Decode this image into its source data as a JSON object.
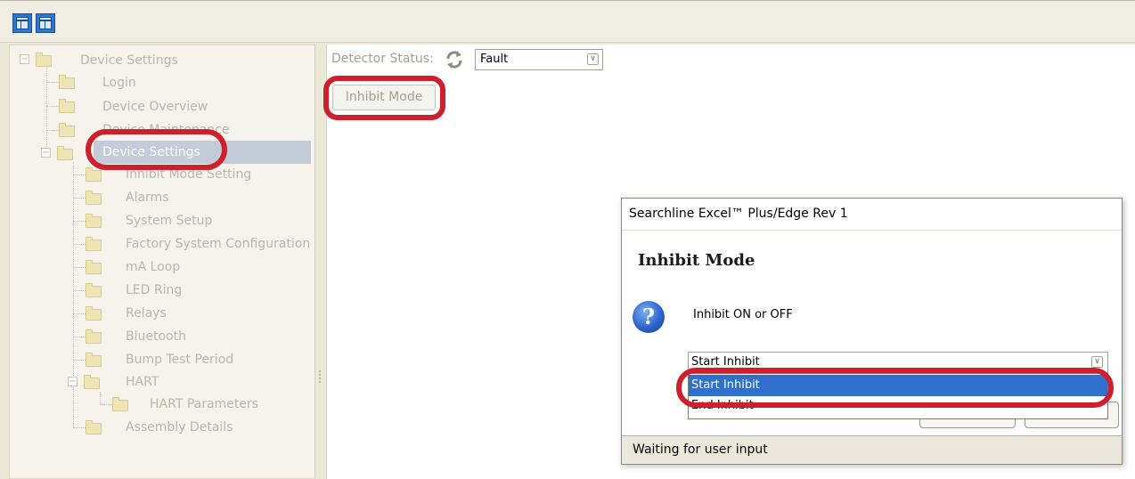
{
  "toolbar": {
    "buttons": [
      {
        "icon": "layout-icon"
      },
      {
        "icon": "layout-split-icon"
      }
    ]
  },
  "tree": {
    "root": "Device Settings",
    "items": [
      {
        "label": "Login"
      },
      {
        "label": "Device Overview"
      },
      {
        "label": "Device Maintenance"
      },
      {
        "label": "Device Settings",
        "selected": true
      },
      {
        "label": "Inhibit Mode Setting"
      },
      {
        "label": "Alarms"
      },
      {
        "label": "System Setup"
      },
      {
        "label": "Factory System Configuration"
      },
      {
        "label": "mA Loop"
      },
      {
        "label": "LED Ring"
      },
      {
        "label": "Relays"
      },
      {
        "label": "Bluetooth"
      },
      {
        "label": "Bump Test Period"
      },
      {
        "label": "HART"
      },
      {
        "label": "HART Parameters"
      },
      {
        "label": "Assembly Details"
      }
    ]
  },
  "detector": {
    "label": "Detector Status:",
    "refresh_icon": "refresh-icon",
    "status_value": "Fault",
    "inhibit_button": "Inhibit Mode"
  },
  "dialog": {
    "title": "Searchline Excel™ Plus/Edge Rev 1",
    "heading": "Inhibit Mode",
    "question_icon": "question-icon",
    "message": "Inhibit ON or OFF",
    "selected_value": "Start Inhibit",
    "options": [
      "Start Inhibit",
      "End Inhibit"
    ],
    "status": "Waiting for user input"
  },
  "colors": {
    "highlight": "#cd1f2c",
    "selection": "#3070cc",
    "tree_selection": "#c5ccd9"
  }
}
